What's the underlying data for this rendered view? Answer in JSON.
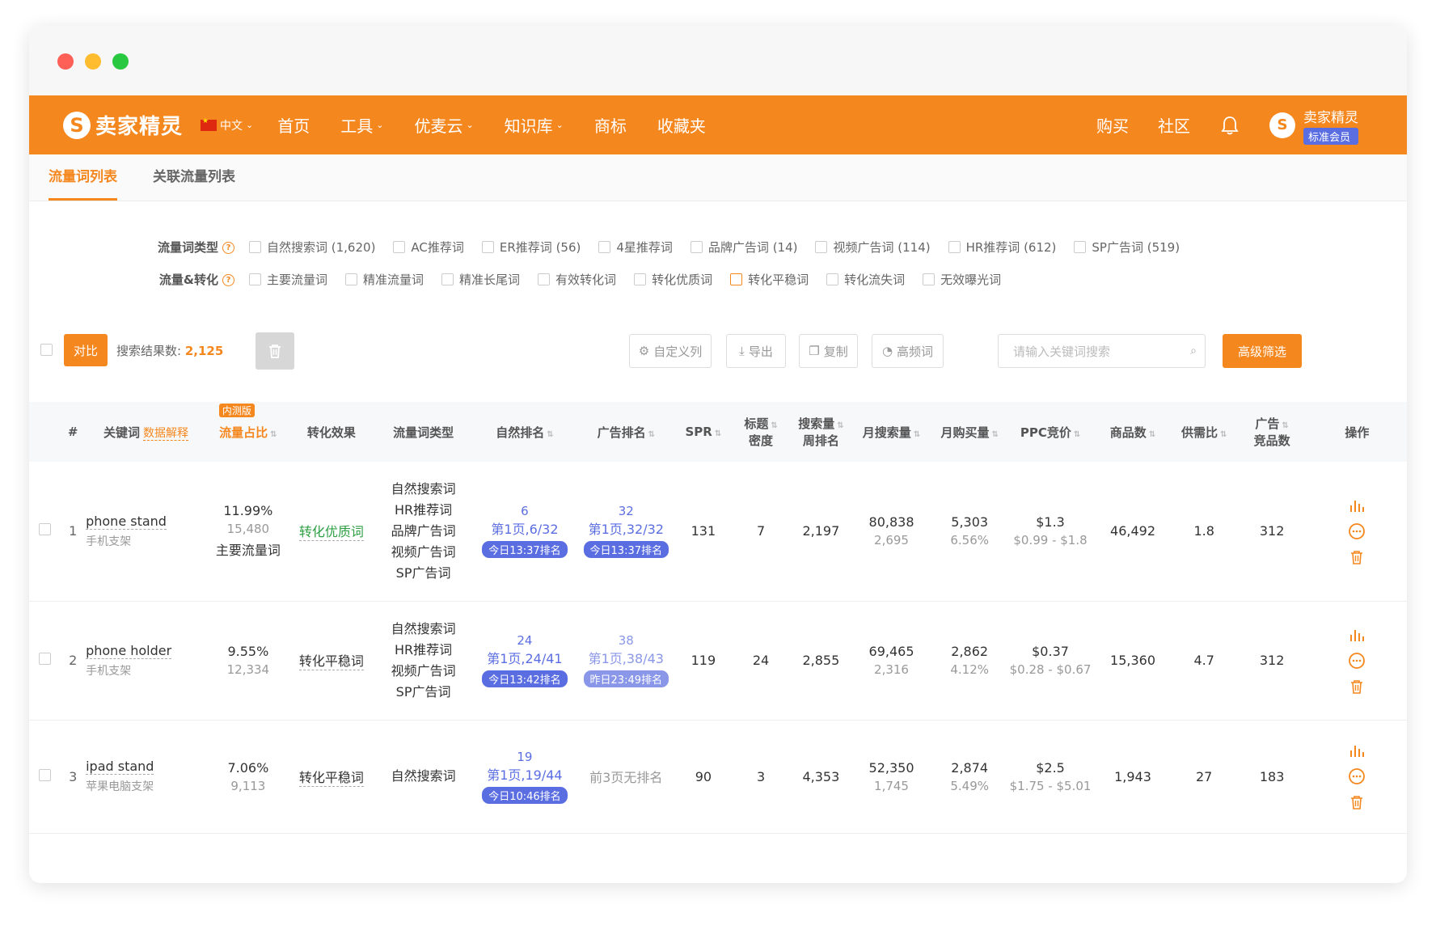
{
  "nav": {
    "logo_text": "卖家精灵",
    "lang": "中文",
    "items": [
      {
        "label": "首页",
        "has_dropdown": false
      },
      {
        "label": "工具",
        "has_dropdown": true
      },
      {
        "label": "优麦云",
        "has_dropdown": true
      },
      {
        "label": "知识库",
        "has_dropdown": true
      },
      {
        "label": "商标",
        "has_dropdown": false
      },
      {
        "label": "收藏夹",
        "has_dropdown": false
      }
    ],
    "buy": "购买",
    "community": "社区",
    "user_name": "卖家精灵",
    "member_level": "标准会员"
  },
  "tabs": [
    "流量词列表",
    "关联流量列表"
  ],
  "filters": {
    "type_label": "流量词类型",
    "type_options": [
      "自然搜索词 (1,620)",
      "AC推荐词",
      "ER推荐词 (56)",
      "4星推荐词",
      "品牌广告词 (14)",
      "视频广告词 (114)",
      "HR推荐词 (612)",
      "SP广告词 (519)"
    ],
    "conv_label": "流量&转化",
    "conv_options": [
      "主要流量词",
      "精准流量词",
      "精准长尾词",
      "有效转化词",
      "转化优质词",
      "转化平稳词",
      "转化流失词",
      "无效曝光词"
    ]
  },
  "toolbar": {
    "compare": "对比",
    "result_label": "搜索结果数:",
    "result_count": "2,125",
    "custom_cols": "自定义列",
    "export": "导出",
    "copy": "复制",
    "high_freq": "高频词",
    "search_placeholder": "请输入关键词搜索",
    "advanced": "高级筛选"
  },
  "table": {
    "headers": {
      "num": "#",
      "keyword": "关键词",
      "data_expl": "数据解释",
      "beta": "内测版",
      "share": "流量占比",
      "effect": "转化效果",
      "types": "流量词类型",
      "organic": "自然排名",
      "ad": "广告排名",
      "spr": "SPR",
      "title_density_1": "标题",
      "title_density_2": "密度",
      "weekly_rank_1": "搜索量",
      "weekly_rank_2": "周排名",
      "monthly_search": "月搜索量",
      "monthly_buy": "月购买量",
      "ppc": "PPC竞价",
      "products": "商品数",
      "supply_ratio": "供需比",
      "ad_products_1": "广告",
      "ad_products_2": "竞品数",
      "ops": "操作"
    },
    "rows": [
      {
        "num": "1",
        "kw_en": "phone stand",
        "kw_cn": "手机支架",
        "share": "11.99%",
        "share_count": "15,480",
        "share_note": "主要流量词",
        "effect": "转化优质词",
        "effect_green": true,
        "types": [
          "自然搜索词",
          "HR推荐词",
          "品牌广告词",
          "视频广告词",
          "SP广告词"
        ],
        "org_num": "6",
        "org_page": "第1页,6/32",
        "org_tag": "今日13:37排名",
        "ad_num": "32",
        "ad_page": "第1页,32/32",
        "ad_tag": "今日13:37排名",
        "ad_light": false,
        "spr": "131",
        "density": "7",
        "weekly": "2,197",
        "msearch": "80,838",
        "msearch_sub": "2,695",
        "mbuy": "5,303",
        "mbuy_sub": "6.56%",
        "ppc": "$1.3",
        "ppc_range": "$0.99 - $1.8",
        "products": "46,492",
        "ratio": "1.8",
        "adprod": "312"
      },
      {
        "num": "2",
        "kw_en": "phone holder",
        "kw_cn": "手机支架",
        "share": "9.55%",
        "share_count": "12,334",
        "share_note": "",
        "effect": "转化平稳词",
        "effect_green": false,
        "types": [
          "自然搜索词",
          "HR推荐词",
          "视频广告词",
          "SP广告词"
        ],
        "org_num": "24",
        "org_page": "第1页,24/41",
        "org_tag": "今日13:42排名",
        "ad_num": "38",
        "ad_page": "第1页,38/43",
        "ad_tag": "昨日23:49排名",
        "ad_light": true,
        "spr": "119",
        "density": "24",
        "weekly": "2,855",
        "msearch": "69,465",
        "msearch_sub": "2,316",
        "mbuy": "2,862",
        "mbuy_sub": "4.12%",
        "ppc": "$0.37",
        "ppc_range": "$0.28 - $0.67",
        "products": "15,360",
        "ratio": "4.7",
        "adprod": "312"
      },
      {
        "num": "3",
        "kw_en": "ipad stand",
        "kw_cn": "苹果电脑支架",
        "share": "7.06%",
        "share_count": "9,113",
        "share_note": "",
        "effect": "转化平稳词",
        "effect_green": false,
        "types": [
          "自然搜索词"
        ],
        "org_num": "19",
        "org_page": "第1页,19/44",
        "org_tag": "今日10:46排名",
        "ad_none": "前3页无排名",
        "spr": "90",
        "density": "3",
        "weekly": "4,353",
        "msearch": "52,350",
        "msearch_sub": "1,745",
        "mbuy": "2,874",
        "mbuy_sub": "5.49%",
        "ppc": "$2.5",
        "ppc_range": "$1.75 - $5.01",
        "products": "1,943",
        "ratio": "27",
        "adprod": "183"
      }
    ]
  },
  "colors": {
    "brand": "#f5871f",
    "rank_blue": "#5b6ee1",
    "effect_green": "#2ea043"
  }
}
